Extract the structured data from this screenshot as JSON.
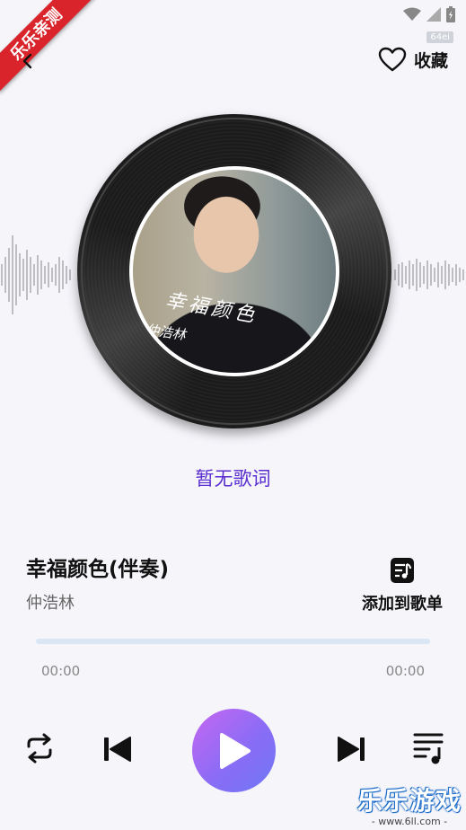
{
  "watermark": {
    "ribbon_text": "乐乐亲测",
    "badge": "64ei",
    "brand": "乐乐游戏",
    "brand_url": "- www.6ll.com -"
  },
  "header": {
    "favorite_label": "收藏"
  },
  "album": {
    "cover_title": "幸福颜色",
    "cover_artist": "仲浩林"
  },
  "lyrics": {
    "text": "暂无歌词"
  },
  "track": {
    "title": "幸福颜色(伴奏)",
    "artist": "仲浩林"
  },
  "actions": {
    "add_playlist_label": "添加到歌单"
  },
  "progress": {
    "current_time": "00:00",
    "total_time": "00:00",
    "fraction": 0
  },
  "colors": {
    "accent": "#5a2ecf",
    "play_gradient_start": "#c767f0",
    "play_gradient_end": "#6f78f7",
    "progress_track": "#dbe6f5",
    "background": "#f5f5fa"
  },
  "icons": {
    "back": "back-arrow-icon",
    "favorite": "heart-outline-icon",
    "add_playlist": "playlist-add-icon",
    "repeat": "repeat-icon",
    "previous": "skip-previous-icon",
    "play": "play-icon",
    "next": "skip-next-icon",
    "queue": "playlist-queue-icon"
  }
}
